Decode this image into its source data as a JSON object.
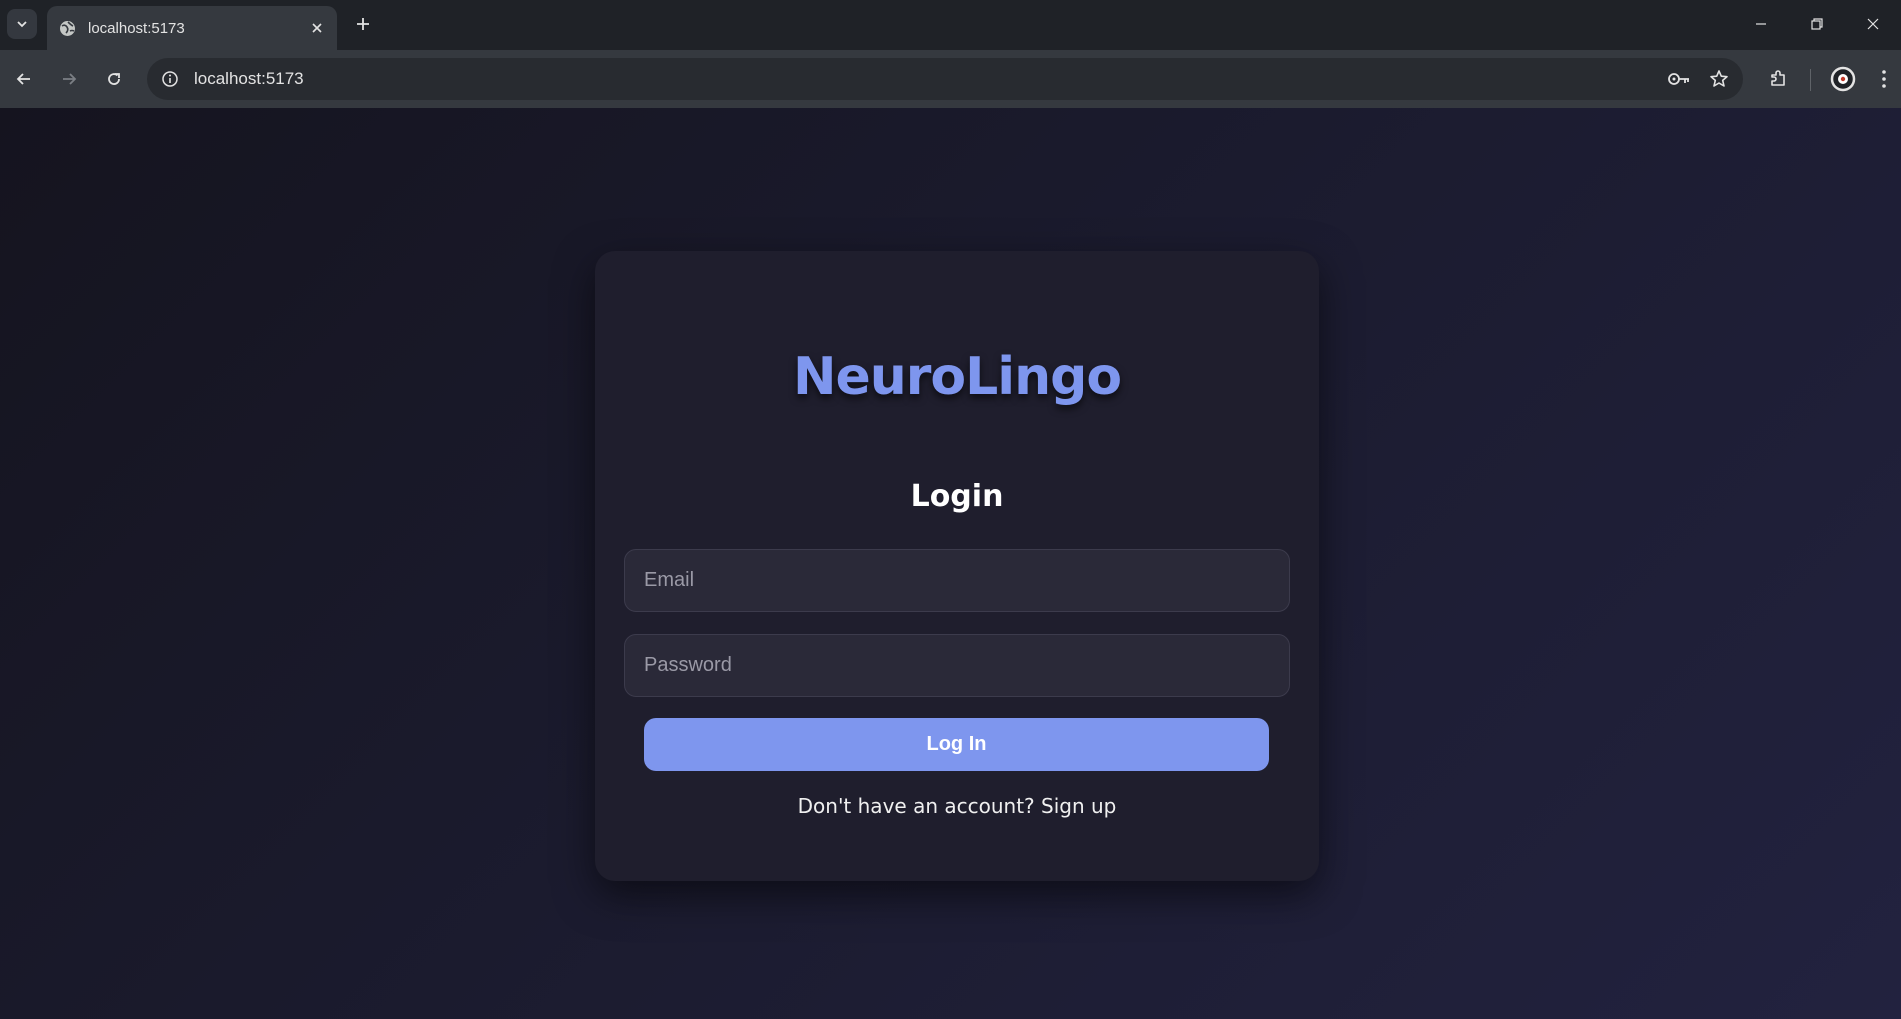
{
  "browser": {
    "tab": {
      "title": "localhost:5173"
    },
    "address_bar": {
      "url": "localhost:5173"
    },
    "icons": {
      "tab_search": "chevron-down-icon",
      "favicon": "globe-icon",
      "tab_close": "close-icon",
      "new_tab": "plus-icon",
      "minimize": "minimize-icon",
      "restore": "restore-icon",
      "close_window": "close-icon",
      "back": "back-arrow-icon",
      "forward": "forward-arrow-icon",
      "reload": "reload-icon",
      "site_info": "info-icon",
      "passwords": "key-icon",
      "bookmark": "star-icon",
      "extensions": "puzzle-icon",
      "profile": "avatar-icon",
      "menu": "kebab-menu-icon"
    }
  },
  "login": {
    "brand": "NeuroLingo",
    "heading": "Login",
    "email_placeholder": "Email",
    "email_value": "",
    "password_placeholder": "Password",
    "password_value": "",
    "submit_label": "Log In",
    "signup_prompt": "Don't have an account?",
    "signup_link": "Sign up"
  },
  "colors": {
    "accent": "#7e96ee",
    "card_background": "#1f1e2d",
    "input_background": "#2a2938",
    "page_background_start": "#15141f",
    "page_background_end": "#22223f"
  }
}
